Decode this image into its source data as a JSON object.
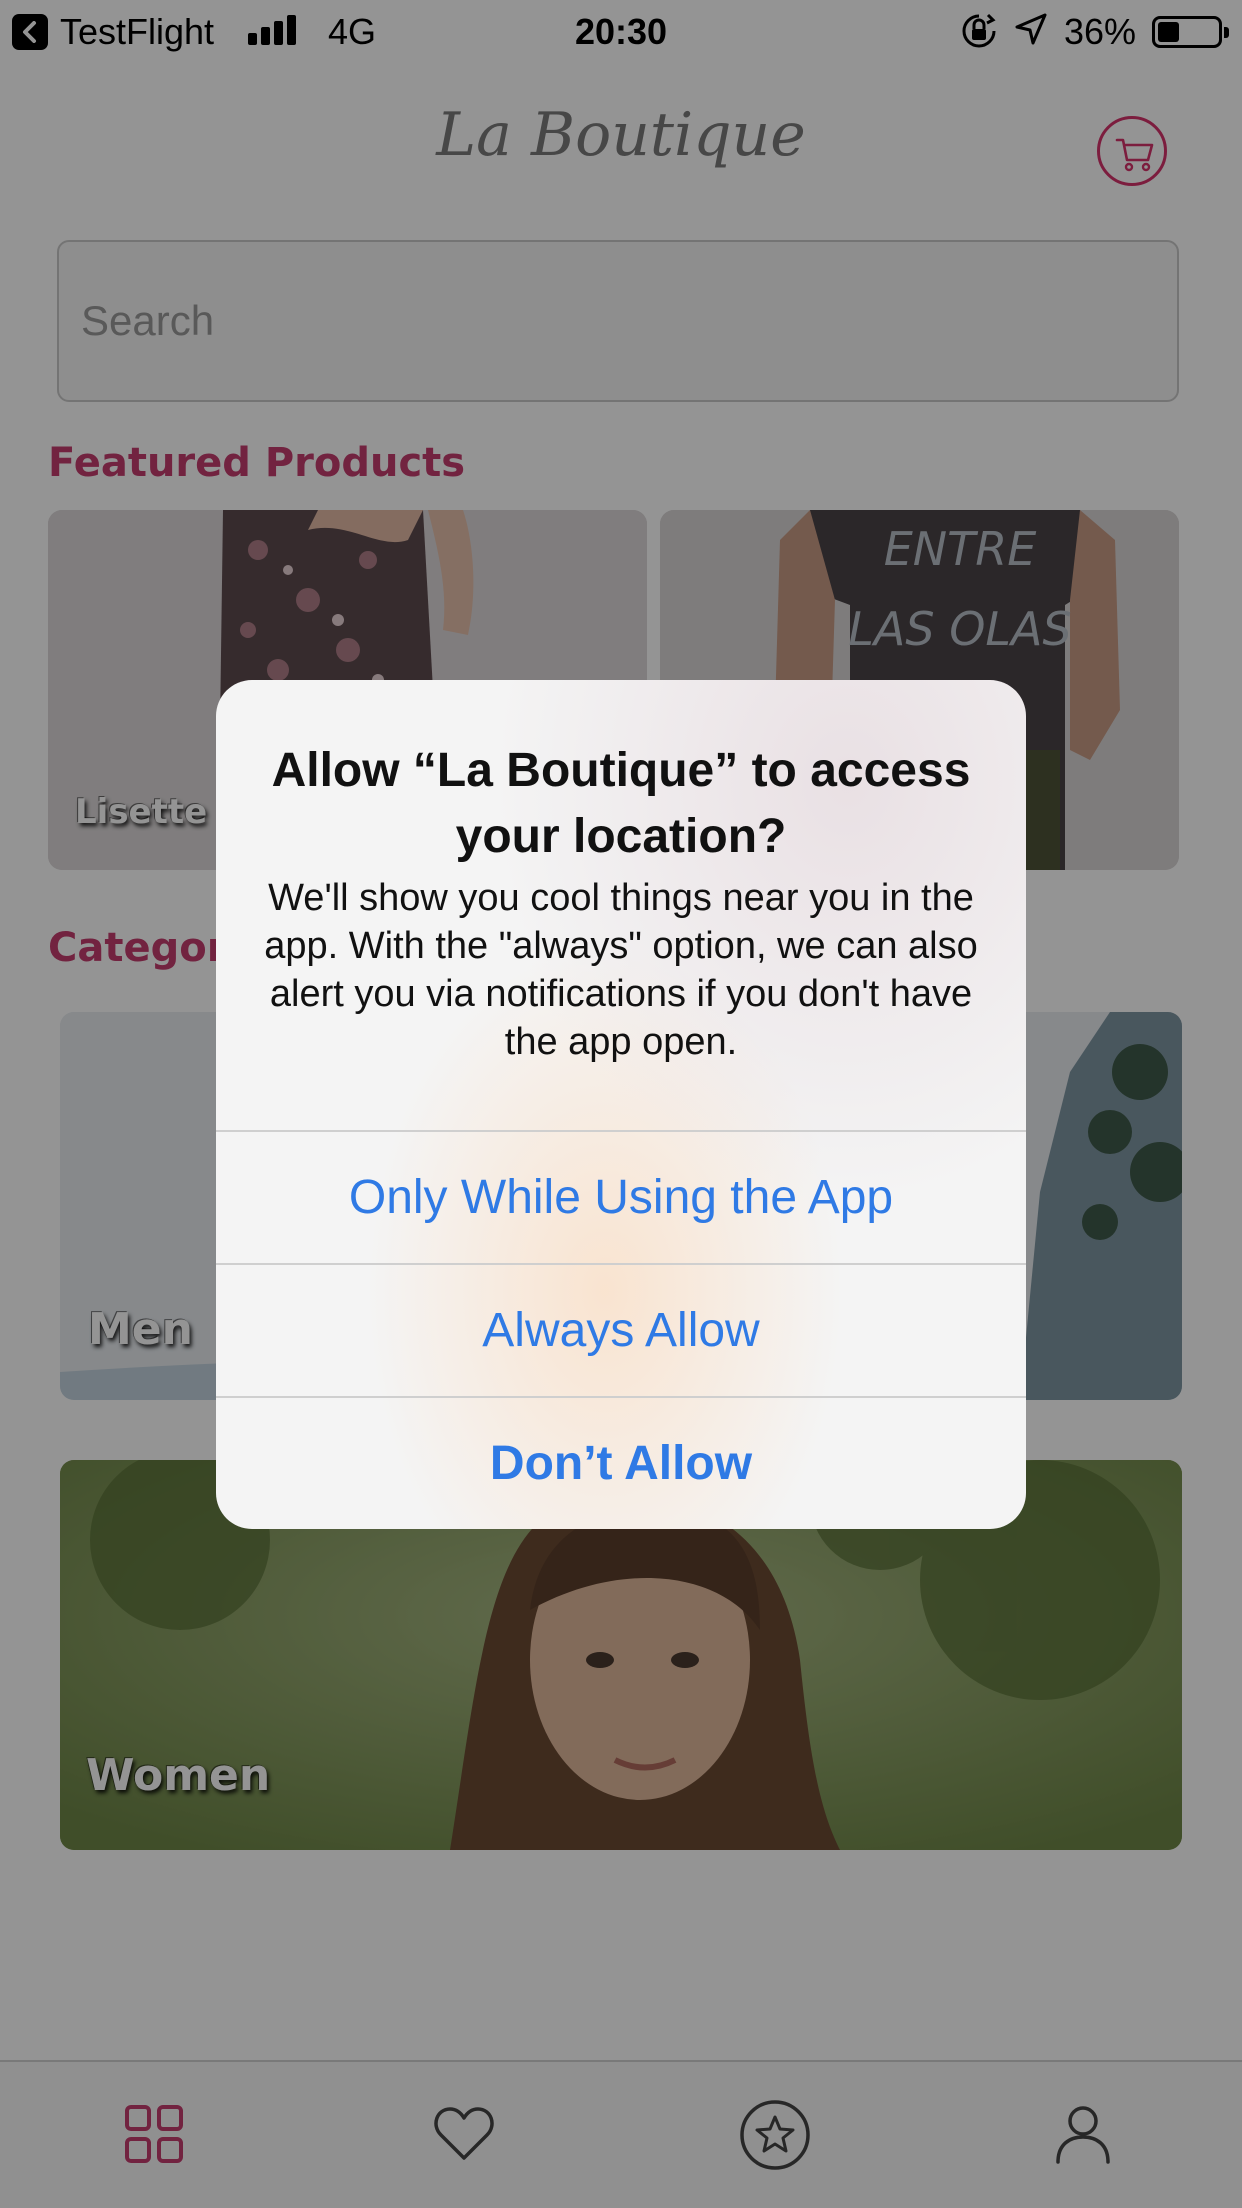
{
  "status_bar": {
    "back_app": "TestFlight",
    "network": "4G",
    "time": "20:30",
    "battery": "36%",
    "battery_level": 0.36
  },
  "header": {
    "title": "La Boutique",
    "cart_icon": "cart-icon"
  },
  "search": {
    "placeholder": "Search"
  },
  "featured": {
    "title": "Featured Products",
    "items": [
      {
        "label": "Lisette"
      },
      {
        "label": ""
      }
    ]
  },
  "categories": {
    "title": "Categories",
    "items": [
      {
        "label": "Men"
      },
      {
        "label": "Women"
      }
    ]
  },
  "tab_bar": {
    "items": [
      {
        "icon": "grid-icon",
        "active": true
      },
      {
        "icon": "heart-icon",
        "active": false
      },
      {
        "icon": "star-icon",
        "active": false
      },
      {
        "icon": "user-icon",
        "active": false
      }
    ]
  },
  "alert": {
    "title": "Allow “La Boutique” to access your location?",
    "message": "We'll show you cool things near you in the app. With the \"always\" option, we can also alert you via notifications if you don't have the app open.",
    "buttons": {
      "while_using": "Only While Using the App",
      "always": "Always Allow",
      "deny": "Don’t Allow"
    }
  },
  "colors": {
    "accent": "#c43d6e",
    "alert_button": "#2f7ae5"
  }
}
